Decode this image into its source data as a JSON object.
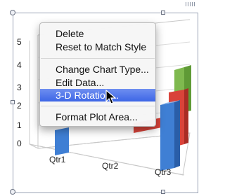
{
  "chart": {
    "y_ticks": [
      "0",
      "1",
      "2",
      "3",
      "4",
      "5"
    ],
    "x_ticks": [
      "Qtr1",
      "Qtr2",
      "Qtr3"
    ]
  },
  "context_menu": {
    "items": [
      {
        "label": "Delete"
      },
      {
        "label": "Reset to Match Style"
      },
      {
        "label": "Change Chart Type..."
      },
      {
        "label": "Edit Data..."
      },
      {
        "label": "3-D Rotation..."
      },
      {
        "label": "Format Plot Area..."
      }
    ],
    "selected_label": "3-D Rotation..."
  },
  "colors": {
    "menu_highlight": "#3d66e6",
    "bar_blue": "#3f7fd4",
    "bar_red": "#d9433a",
    "bar_green": "#8ec760"
  }
}
